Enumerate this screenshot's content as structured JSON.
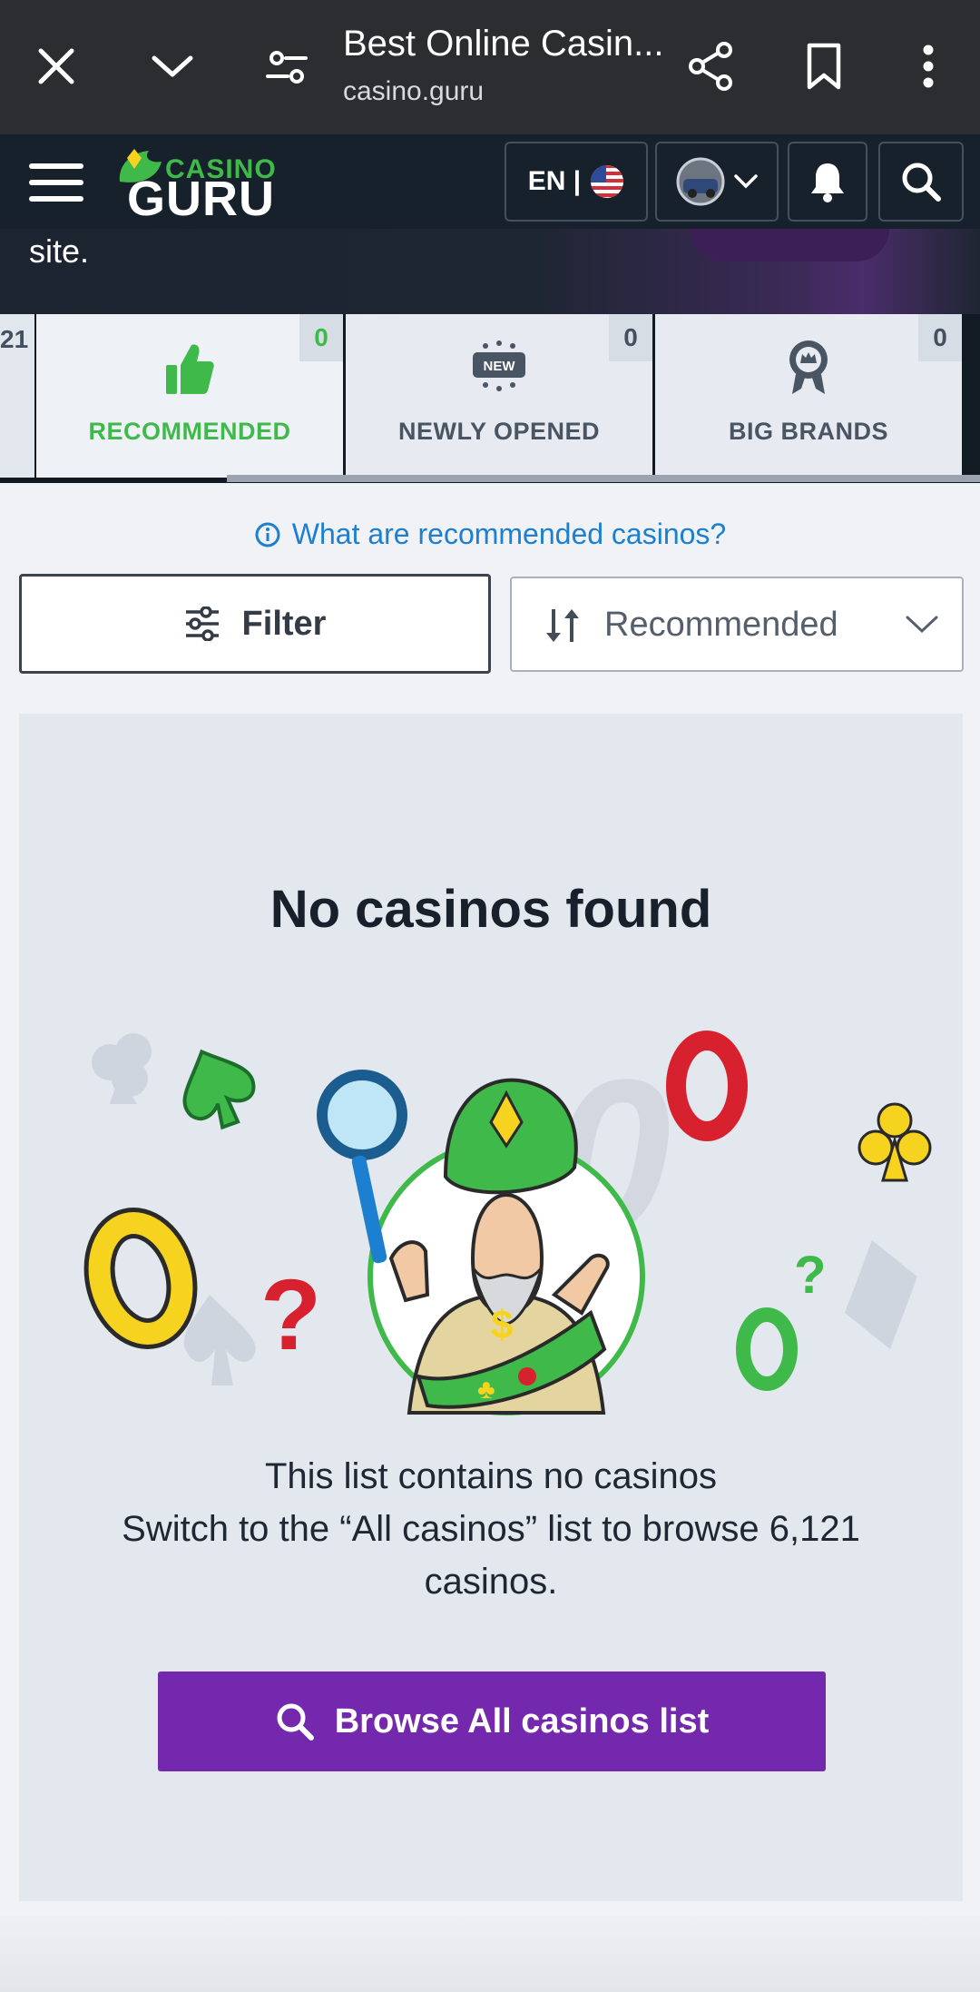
{
  "browser": {
    "title": "Best Online Casin...",
    "url": "casino.guru"
  },
  "header": {
    "logo_top": "CASINO",
    "logo_bottom": "GURU",
    "language": "EN |"
  },
  "hero": {
    "text": "site."
  },
  "tabs": {
    "partial_left": "21",
    "items": [
      {
        "label": "RECOMMENDED",
        "count": "0",
        "active": true
      },
      {
        "label": "NEWLY OPENED",
        "count": "0",
        "badge": "NEW"
      },
      {
        "label": "BIG BRANDS",
        "count": "0"
      }
    ]
  },
  "info_link": "What are recommended casinos?",
  "filter": {
    "label": "Filter"
  },
  "sort": {
    "selected": "Recommended"
  },
  "empty_state": {
    "title": "No casinos found",
    "line1": "This list contains no casinos",
    "line2": "Switch to the “All casinos” list to browse 6,121",
    "line3": "casinos.",
    "button": "Browse All casinos list"
  },
  "colors": {
    "accent_green": "#3fba4a",
    "link_blue": "#1c7fcf",
    "button_purple": "#7328ae"
  }
}
